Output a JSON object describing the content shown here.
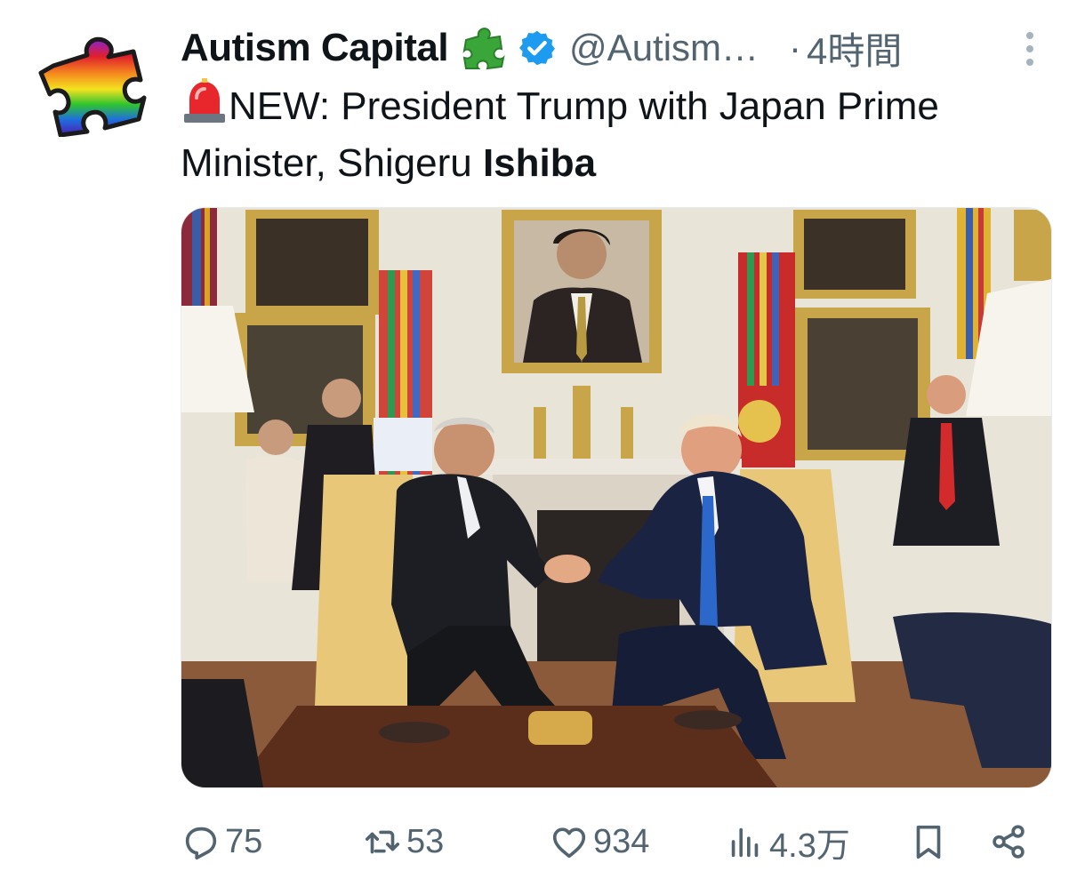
{
  "tweet": {
    "author_name": "Autism Capital",
    "handle": "@Autism…",
    "separator": "·",
    "time": "4時間",
    "text_prefix": "NEW: President Trump with Japan Prime Minister, Shigeru ",
    "text_bold": "Ishiba"
  },
  "icons": {
    "avatar": "rainbow-puzzle-piece",
    "name_emoji": "green-puzzle-piece",
    "verified": "verified-badge",
    "siren": "police-light-emoji",
    "more": "vertical-ellipsis"
  },
  "actions": {
    "reply_count": "75",
    "repost_count": "53",
    "like_count": "934",
    "views_count": "4.3万"
  },
  "colors": {
    "secondary_text": "#536471",
    "verified_blue": "#1d9bf0",
    "puzzle_green": "#3aa63a"
  }
}
